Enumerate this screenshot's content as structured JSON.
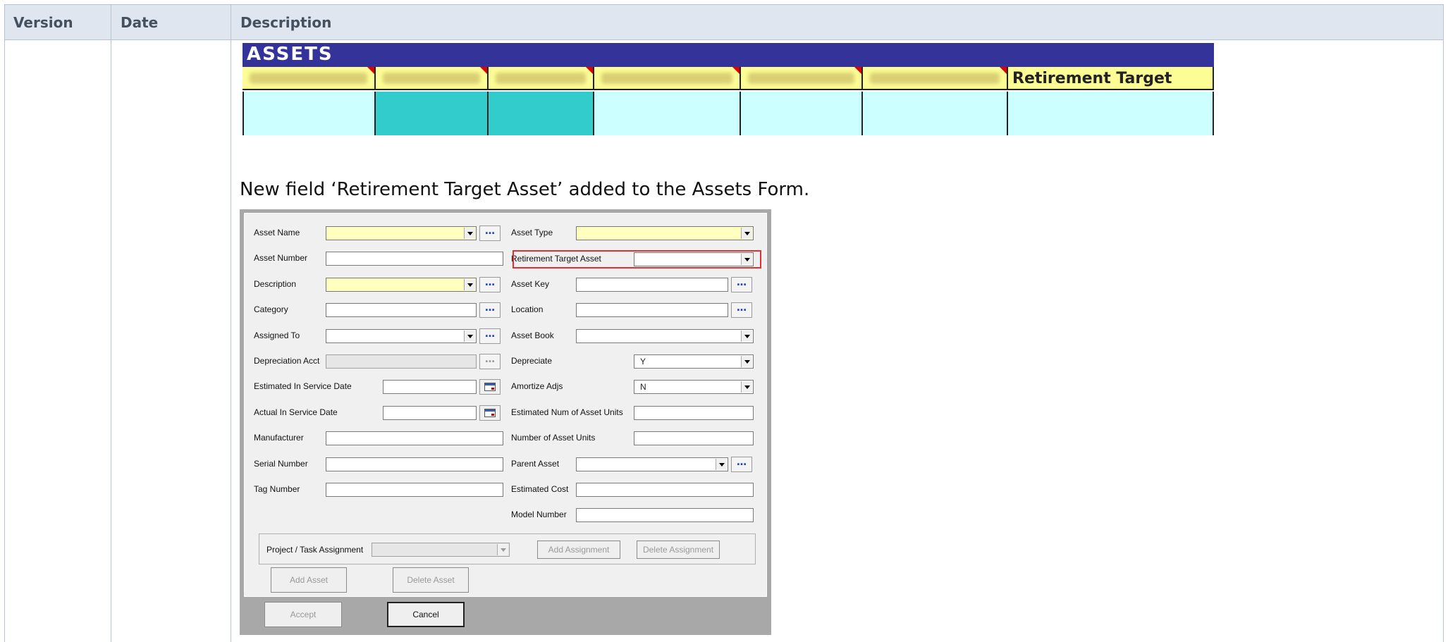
{
  "table": {
    "headers": [
      "Version",
      "Date",
      "Description"
    ]
  },
  "assets_grid": {
    "title": "ASSETS",
    "named_column": "Retirement Target Asset"
  },
  "caption": "New field ‘Retirement Target Asset’ added to the Assets Form.",
  "form": {
    "left_labels": {
      "asset_name": "Asset Name",
      "asset_number": "Asset Number",
      "description": "Description",
      "category": "Category",
      "assigned_to": "Assigned To",
      "depreciation_acct": "Depreciation Acct",
      "est_in_service": "Estimated In Service Date",
      "act_in_service": "Actual In Service Date",
      "manufacturer": "Manufacturer",
      "serial_number": "Serial Number",
      "tag_number": "Tag Number"
    },
    "right_labels": {
      "asset_type": "Asset Type",
      "retirement_target": "Retirement Target Asset",
      "asset_key": "Asset Key",
      "location": "Location",
      "asset_book": "Asset Book",
      "depreciate": "Depreciate",
      "amortize_adjs": "Amortize Adjs",
      "est_num_units": "Estimated Num of Asset Units",
      "num_units": "Number of Asset Units",
      "parent_asset": "Parent Asset",
      "estimated_cost": "Estimated Cost",
      "model_number": "Model Number"
    },
    "values": {
      "depreciate": "Y",
      "amortize_adjs": "N"
    },
    "ellipsis": "…",
    "project_task_label": "Project / Task Assignment",
    "buttons": {
      "add_assignment": "Add Assignment",
      "delete_assignment": "Delete Assignment",
      "add_asset": "Add Asset",
      "delete_asset": "Delete Asset",
      "accept": "Accept",
      "cancel": "Cancel"
    }
  }
}
